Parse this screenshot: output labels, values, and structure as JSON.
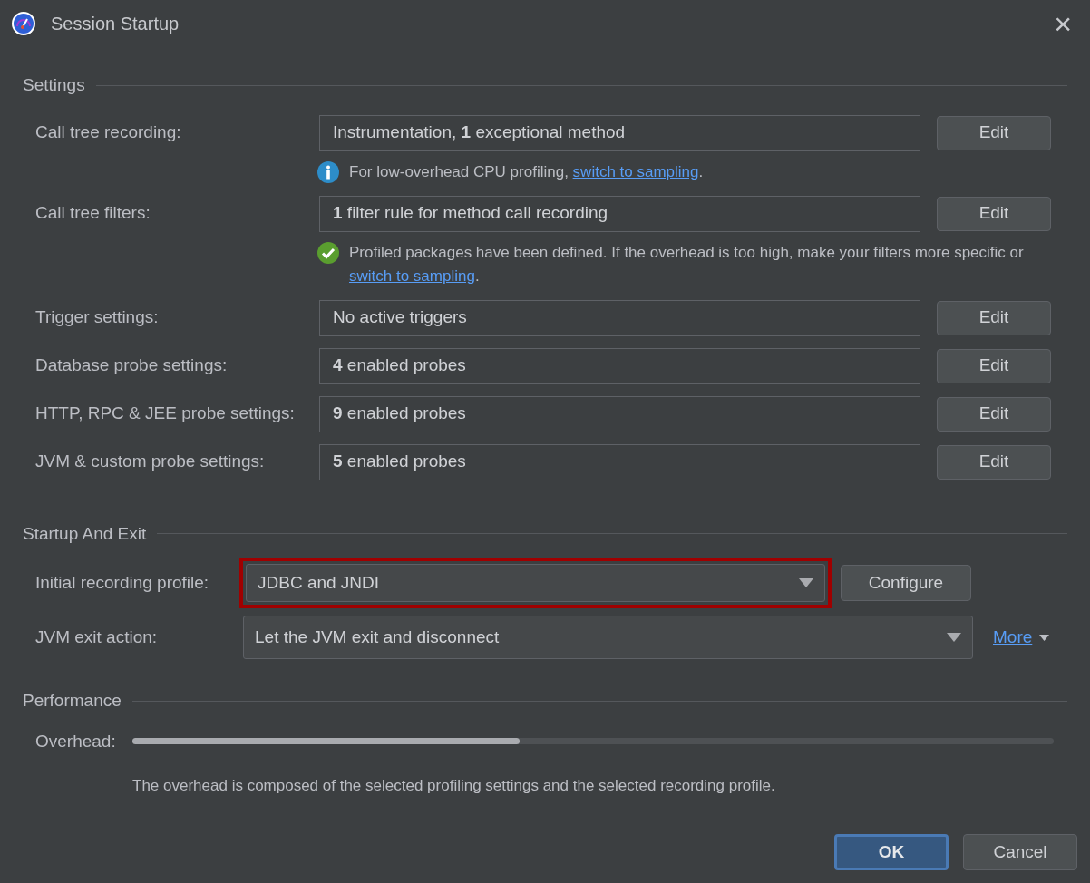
{
  "window": {
    "title": "Session Startup",
    "close": "×"
  },
  "settings": {
    "heading": "Settings",
    "rows": [
      {
        "label": "Call tree recording:",
        "value": "Instrumentation, **1** exceptional method",
        "button": "Edit",
        "note": {
          "kind": "info",
          "text": "For low-overhead CPU profiling, ",
          "link": "switch to sampling",
          "suffix": "."
        }
      },
      {
        "label": "Call tree filters:",
        "value": "**1** filter rule for method call recording",
        "button": "Edit",
        "note": {
          "kind": "success",
          "text": "Profiled packages have been defined. If the overhead is too high, make your filters more specific or ",
          "link": "switch to sampling",
          "suffix": "."
        }
      },
      {
        "label": "Trigger settings:",
        "value": "No active triggers",
        "button": "Edit"
      },
      {
        "label": "Database probe settings:",
        "value": "**4** enabled probes",
        "button": "Edit"
      },
      {
        "label": "HTTP, RPC & JEE probe settings:",
        "value": "**9** enabled probes",
        "button": "Edit"
      },
      {
        "label": "JVM & custom probe settings:",
        "value": "**5** enabled probes",
        "button": "Edit"
      }
    ]
  },
  "startup": {
    "heading": "Startup And Exit",
    "rows": [
      {
        "label": "Initial recording profile:",
        "value": "JDBC and JNDI",
        "highlighted": true,
        "kind": "button",
        "button": "Configure"
      },
      {
        "label": "JVM exit action:",
        "value": "Let the JVM exit and disconnect",
        "highlighted": false,
        "kind": "link",
        "link": "More"
      }
    ]
  },
  "performance": {
    "heading": "Performance",
    "label": "Overhead:",
    "level": 0.42,
    "description": "The overhead is composed of the selected profiling settings and the selected recording profile."
  },
  "buttons": [
    {
      "label": "OK",
      "default": true
    },
    {
      "label": "Cancel",
      "default": false
    }
  ]
}
